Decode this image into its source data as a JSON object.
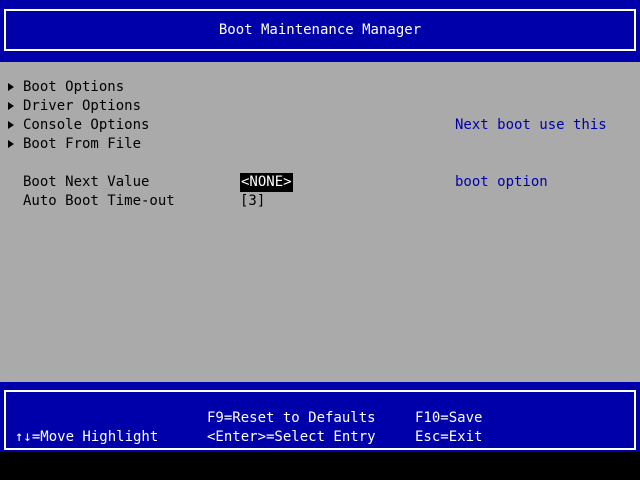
{
  "header": {
    "title": "Boot Maintenance Manager"
  },
  "menu": {
    "items": [
      {
        "label": "Boot Options",
        "icon": "triangle-right-icon"
      },
      {
        "label": "Driver Options",
        "icon": "triangle-right-icon"
      },
      {
        "label": "Console Options",
        "icon": "triangle-right-icon"
      },
      {
        "label": "Boot From File",
        "icon": "triangle-right-icon"
      }
    ]
  },
  "settings": {
    "boot_next": {
      "label": "Boot Next Value",
      "value": "<NONE>"
    },
    "auto_boot": {
      "label": "Auto Boot Time-out",
      "value": "[3]"
    }
  },
  "help": {
    "line1": "Next boot use this",
    "line2": "boot option"
  },
  "footer": {
    "move_highlight": "↑↓=Move Highlight",
    "reset_defaults": "F9=Reset to Defaults",
    "select_entry": "<Enter>=Select Entry",
    "save": "F10=Save",
    "exit": "Esc=Exit"
  },
  "colors": {
    "header_bg": "#0000aa",
    "body_bg": "#aaaaaa",
    "help_text": "#0000aa",
    "text": "#000000",
    "inverse_text": "#ffffff"
  }
}
